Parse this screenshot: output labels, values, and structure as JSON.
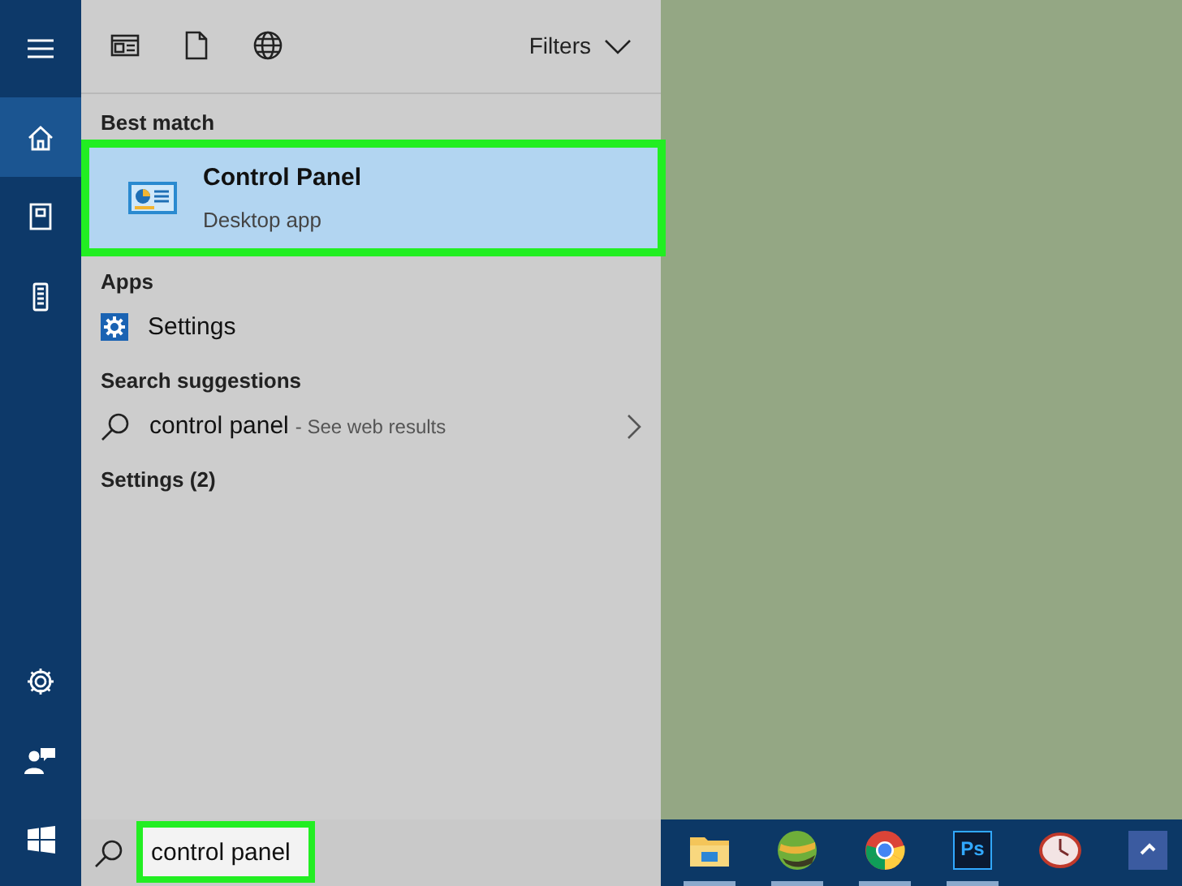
{
  "rail": {
    "top": [
      {
        "kind": "menu",
        "selected": false
      },
      {
        "kind": "home",
        "selected": true
      },
      {
        "kind": "notebook",
        "selected": false
      },
      {
        "kind": "device",
        "selected": false
      }
    ],
    "bottom": [
      {
        "kind": "settings"
      },
      {
        "kind": "feedback"
      },
      {
        "kind": "start"
      }
    ]
  },
  "toolbar": {
    "scopes": [
      {
        "kind": "apps"
      },
      {
        "kind": "documents"
      },
      {
        "kind": "web"
      }
    ],
    "filters": "Filters"
  },
  "sections": [
    {
      "heading": "Best match",
      "items": [
        {
          "kind": "app",
          "title": "Control Panel",
          "subtitle": "Desktop app",
          "selected": true,
          "highlighted": true
        }
      ]
    },
    {
      "heading": "Apps",
      "items": [
        {
          "kind": "settings",
          "title": "Settings",
          "selected": false,
          "highlighted": false
        }
      ]
    },
    {
      "heading": "Search suggestions",
      "items": [
        {
          "kind": "web",
          "title": "control panel",
          "suffix": "- See web results",
          "selected": false,
          "highlighted": false
        }
      ]
    },
    {
      "heading": "Settings (2)"
    }
  ],
  "search": {
    "value": "control panel",
    "highlighted": true
  },
  "taskbar": [
    {
      "kind": "explorer",
      "running": true
    },
    {
      "kind": "maps",
      "running": true
    },
    {
      "kind": "chrome",
      "running": true
    },
    {
      "kind": "photoshop",
      "label": "Ps",
      "running": true
    },
    {
      "kind": "clock",
      "running": false
    },
    {
      "kind": "tile",
      "running": false
    }
  ]
}
